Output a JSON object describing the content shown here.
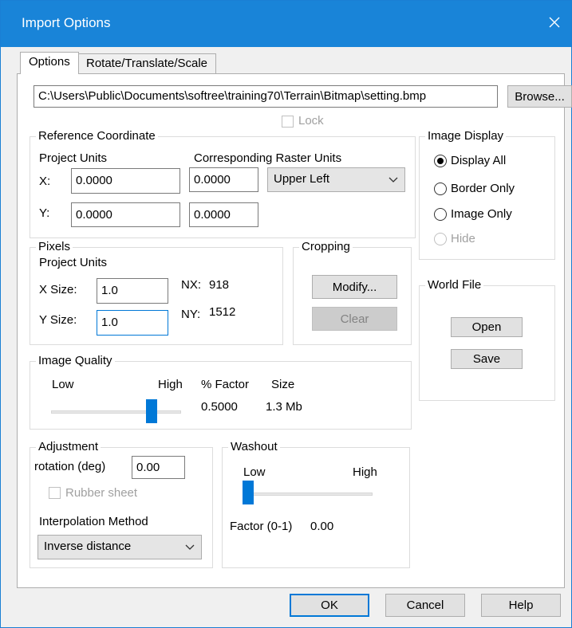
{
  "window": {
    "title": "Import Options"
  },
  "tabs": [
    {
      "label": "Options",
      "active": true
    },
    {
      "label": "Rotate/Translate/Scale",
      "active": false
    }
  ],
  "file": {
    "path": "C:\\Users\\Public\\Documents\\softree\\training70\\Terrain\\Bitmap\\setting.bmp",
    "browse_label": "Browse...",
    "lock_label": "Lock",
    "lock_checked": false
  },
  "reference": {
    "title": "Reference Coordinate",
    "project_units_label": "Project Units",
    "raster_units_label": "Corresponding Raster Units",
    "x_label": "X:",
    "y_label": "Y:",
    "x_value": "0.0000",
    "y_value": "0.0000",
    "raster_x_value": "0.0000",
    "raster_y_value": "0.0000",
    "corner_selected": "Upper Left"
  },
  "image_display": {
    "title": "Image Display",
    "options": [
      {
        "label": "Display All",
        "selected": true,
        "enabled": true
      },
      {
        "label": "Border Only",
        "selected": false,
        "enabled": true
      },
      {
        "label": "Image Only",
        "selected": false,
        "enabled": true
      },
      {
        "label": "Hide",
        "selected": false,
        "enabled": false
      }
    ]
  },
  "pixels": {
    "title": "Pixels",
    "project_units_label": "Project Units",
    "x_size_label": "X Size:",
    "y_size_label": "Y Size:",
    "x_size_value": "1.0",
    "y_size_value": "1.0",
    "nx_label": "NX:",
    "nx_value": "918",
    "ny_label": "NY:",
    "ny_value": "1512"
  },
  "cropping": {
    "title": "Cropping",
    "modify_label": "Modify...",
    "clear_label": "Clear"
  },
  "world_file": {
    "title": "World File",
    "open_label": "Open",
    "save_label": "Save"
  },
  "image_quality": {
    "title": "Image Quality",
    "low_label": "Low",
    "high_label": "High",
    "factor_label": "% Factor",
    "factor_value": "0.5000",
    "size_label": "Size",
    "size_value": "1.3 Mb",
    "slider_level": 0.8
  },
  "adjustment": {
    "title": "Adjustment",
    "rotation_label": "rotation (deg)",
    "rotation_value": "0.00",
    "rubber_sheet_label": "Rubber sheet",
    "interp_label": "Interpolation Method",
    "interp_selected": "Inverse distance"
  },
  "washout": {
    "title": "Washout",
    "low_label": "Low",
    "high_label": "High",
    "factor_label": "Factor (0-1)",
    "factor_value": "0.00",
    "slider_level": 0.0
  },
  "footer": {
    "ok_label": "OK",
    "cancel_label": "Cancel",
    "help_label": "Help"
  },
  "colors": {
    "titlebar": "#1984d8",
    "accent": "#0078d7"
  }
}
